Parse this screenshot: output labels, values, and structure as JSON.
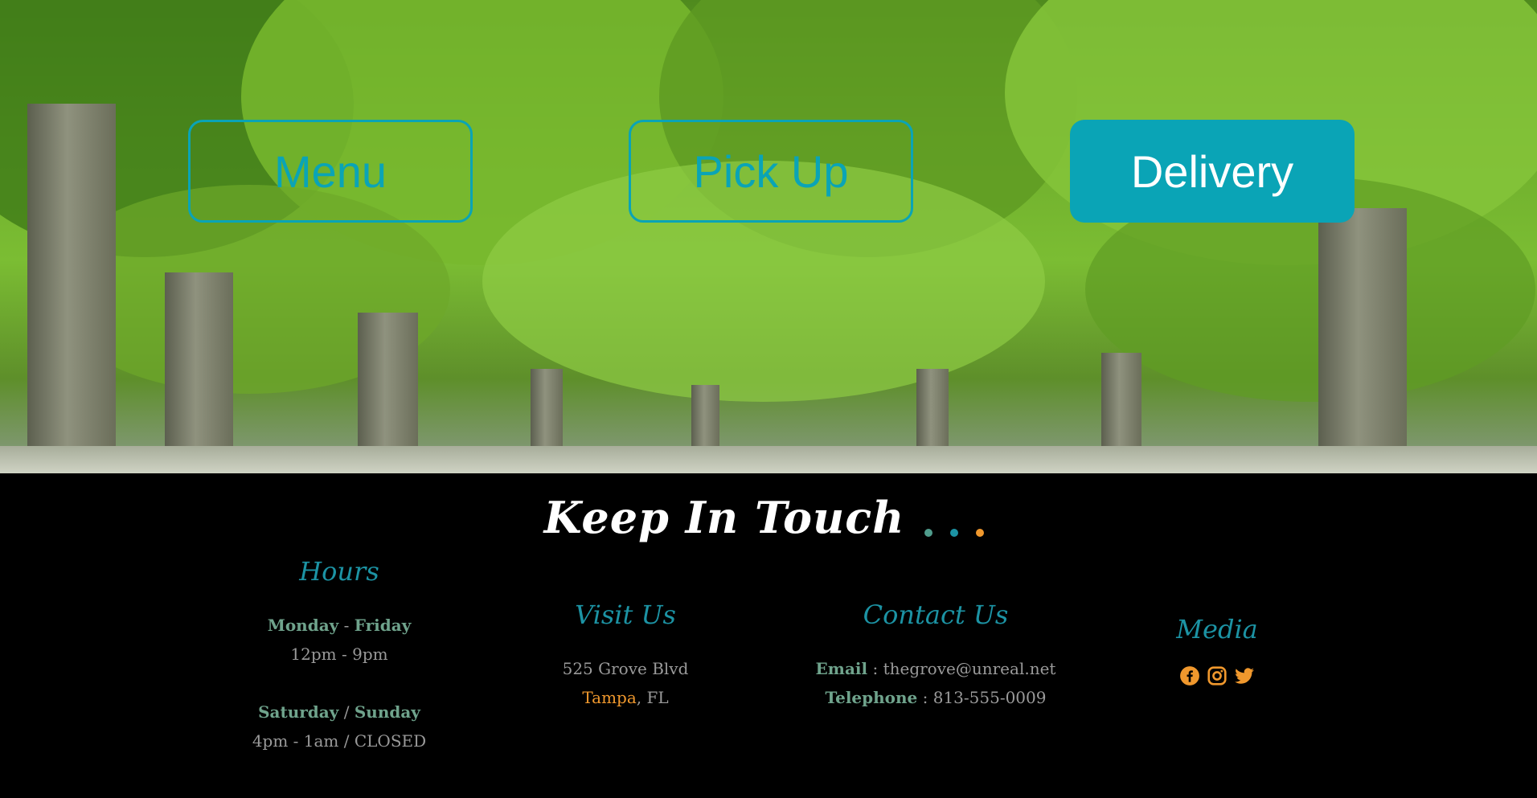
{
  "hero": {
    "buttons": [
      {
        "label": "Menu"
      },
      {
        "label": "Pick Up"
      },
      {
        "label": "Delivery"
      }
    ]
  },
  "footer": {
    "title": "Keep In Touch",
    "dot_colors": [
      "#4f9c8c",
      "#1c93a4",
      "#f0982d"
    ],
    "hours": {
      "heading": "Hours",
      "day1_a": "Monday",
      "day1_sep": " - ",
      "day1_b": "Friday",
      "time1": "12pm - 9pm",
      "day2_a": "Saturday",
      "day2_sep": " / ",
      "day2_b": "Sunday",
      "time2": "4pm - 1am / CLOSED"
    },
    "visit": {
      "heading": "Visit Us",
      "street": "525 Grove Blvd",
      "city": "Tampa",
      "state": ", FL"
    },
    "contact": {
      "heading": "Contact Us",
      "email_label": "Email",
      "email_sep": " : ",
      "email": "thegrove@unreal.net",
      "phone_label": "Telephone",
      "phone_sep": " : ",
      "phone": "813-555-0009"
    },
    "media": {
      "heading": "Media",
      "icons": [
        "facebook-icon",
        "instagram-icon",
        "twitter-icon"
      ],
      "icon_color": "#f0982d"
    }
  },
  "colors": {
    "accent": "#0aa4b6",
    "heading": "#1c93a4",
    "label_green": "#6fa38c",
    "orange": "#f0982d",
    "text_gray": "#9a9a9a"
  }
}
